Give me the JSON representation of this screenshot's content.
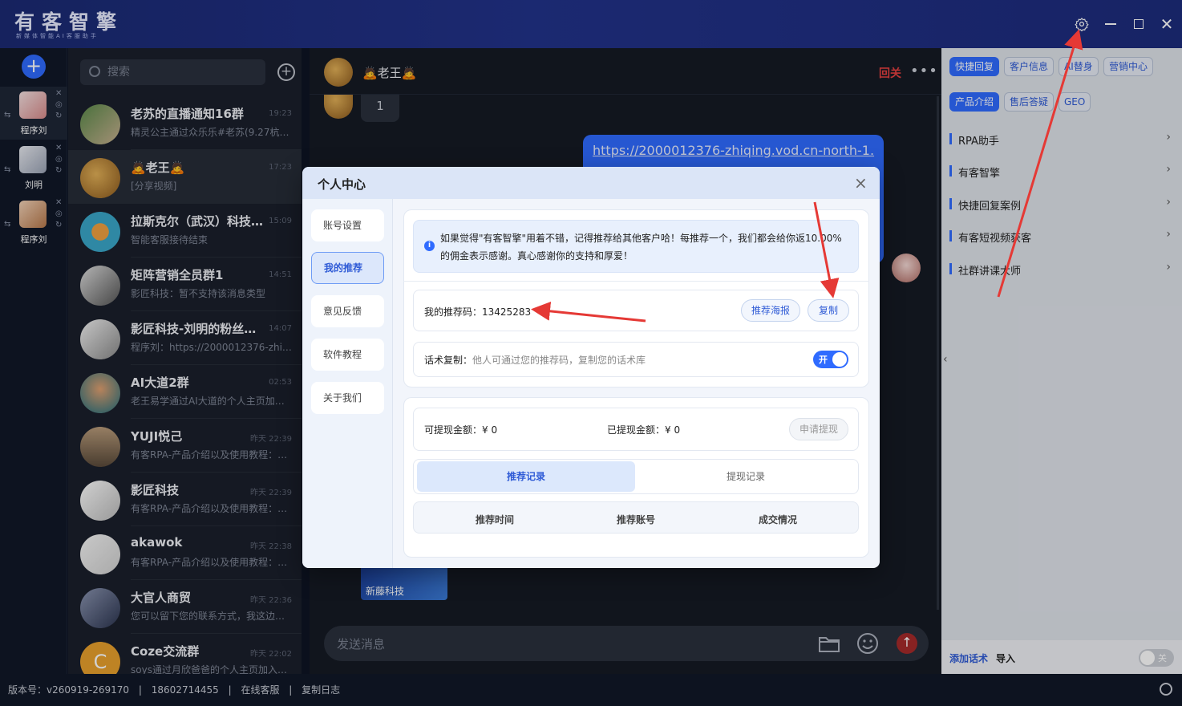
{
  "app": {
    "title": "有客智擎",
    "subtitle": "新媒体智能AI客服助手"
  },
  "left_strip": {
    "accounts": [
      {
        "name": "程序刘"
      },
      {
        "name": "刘明"
      },
      {
        "name": "程序刘"
      }
    ]
  },
  "chat_list": {
    "search_placeholder": "搜索",
    "items": [
      {
        "name": "老苏的直播通知16群",
        "time": "19:23",
        "preview": "精灵公主通过众乐乐#老苏(9.27杭…"
      },
      {
        "name": "🙇老王🙇",
        "time": "17:23",
        "preview": "[分享视频]"
      },
      {
        "name": "拉斯克尔（武汉）科技…",
        "time": "15:09",
        "preview": "智能客服接待结束"
      },
      {
        "name": "矩阵营销全员群1",
        "time": "14:51",
        "preview": "影匠科技：暂不支持该消息类型"
      },
      {
        "name": "影匠科技-刘明的粉丝…",
        "time": "14:07",
        "preview": "程序刘：https://2000012376-zhi…"
      },
      {
        "name": "AI大道2群",
        "time": "02:53",
        "preview": "老王易学通过AI大道的个人主页加…"
      },
      {
        "name": "YUJI悦己",
        "time": "昨天 22:39",
        "preview": "有客RPA-产品介绍以及使用教程：…"
      },
      {
        "name": "影匠科技",
        "time": "昨天 22:39",
        "preview": "有客RPA-产品介绍以及使用教程：…"
      },
      {
        "name": "akawok",
        "time": "昨天 22:38",
        "preview": "有客RPA-产品介绍以及使用教程：…"
      },
      {
        "name": "大官人商贸",
        "time": "昨天 22:36",
        "preview": "您可以留下您的联系方式，我这边…"
      },
      {
        "name": "Coze交流群",
        "time": "昨天 22:02",
        "preview": "soys通过月欣爸爸的个人主页加入…"
      }
    ]
  },
  "chat": {
    "contact_name": "🙇老王🙇",
    "return_label": "回关",
    "more_label": "•••",
    "message_number": "1",
    "link_text": "https://2000012376-zhiqing.vod.cn-north-1.",
    "video_caption": "新藤科技",
    "input_placeholder": "发送消息"
  },
  "right_panel": {
    "tabs_row1": [
      "快捷回复",
      "客户信息",
      "AI替身",
      "营销中心"
    ],
    "tabs_row2": [
      "产品介绍",
      "售后答疑",
      "GEO"
    ],
    "items": [
      "RPA助手",
      "有客智擎",
      "快捷回复案例",
      "有客短视频获客",
      "社群讲课大师"
    ],
    "add_label": "添加话术",
    "import_label": "导入",
    "switch_label": "关"
  },
  "status_bar": {
    "version": "版本号：v260919-269170",
    "phone": "18602714455",
    "service": "在线客服",
    "copy_log": "复制日志",
    "sep": "|"
  },
  "modal": {
    "title": "个人中心",
    "close": "×",
    "nav": [
      "账号设置",
      "我的推荐",
      "意见反馈",
      "软件教程",
      "关于我们"
    ],
    "active_nav": "我的推荐",
    "notice": "如果觉得\"有客智擎\"用着不错，记得推荐给其他客户哈！每推荐一个，我们都会给你返10.00%的佣金表示感谢。真心感谢你的支持和厚爱！",
    "referral_label": "我的推荐码：",
    "referral_code": "13425283",
    "poster_button": "推荐海报",
    "copy_button": "复制",
    "script_copy_label": "话术复制：",
    "script_copy_desc": "他人可通过您的推荐码，复制您的话术库",
    "toggle_label": "开",
    "toggle_on": true,
    "withdrawable_label": "可提现金额：¥ 0",
    "withdrawn_label": "已提现金额：¥ 0",
    "withdraw_button": "申请提现",
    "record_tabs": [
      "推荐记录",
      "提现记录"
    ],
    "table_headers": [
      "推荐时间",
      "推荐账号",
      "成交情况"
    ]
  },
  "colors": {
    "accent": "#2f6bff",
    "title_bar": "#1b2a73",
    "annotation": "#e53935"
  }
}
